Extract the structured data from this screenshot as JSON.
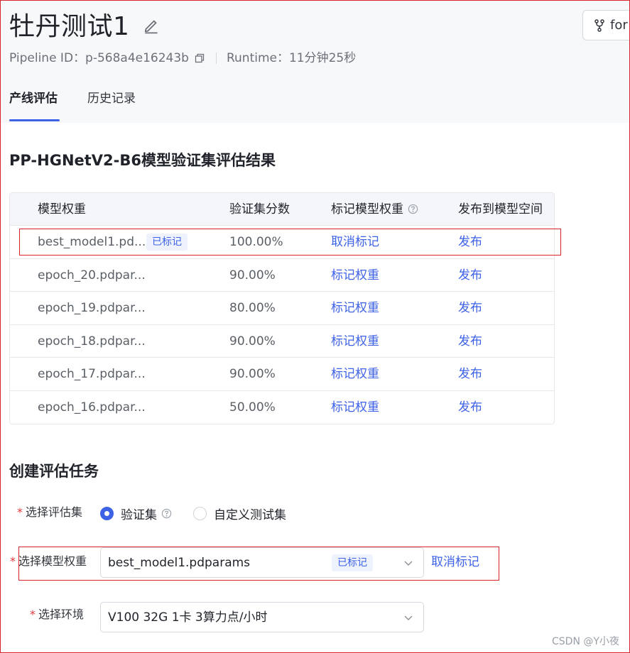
{
  "header": {
    "title": "牡丹测试1",
    "fork_label": "for",
    "pipeline_id": "Pipeline ID：p-568a4e16243b",
    "runtime": "Runtime：11分钟25秒"
  },
  "tabs": [
    {
      "label": "产线评估",
      "active": true
    },
    {
      "label": "历史记录",
      "active": false
    }
  ],
  "results": {
    "title": "PP-HGNetV2-B6模型验证集评估结果",
    "columns": [
      "模型权重",
      "验证集分数",
      "标记模型权重",
      "发布到模型空间"
    ],
    "rows": [
      {
        "weight": "best_model1.pd...",
        "badge": "已标记",
        "score": "100.00%",
        "mark": "取消标记",
        "publish": "发布"
      },
      {
        "weight": "epoch_20.pdpar...",
        "badge": "",
        "score": "90.00%",
        "mark": "标记权重",
        "publish": "发布"
      },
      {
        "weight": "epoch_19.pdpar...",
        "badge": "",
        "score": "80.00%",
        "mark": "标记权重",
        "publish": "发布"
      },
      {
        "weight": "epoch_18.pdpar...",
        "badge": "",
        "score": "90.00%",
        "mark": "标记权重",
        "publish": "发布"
      },
      {
        "weight": "epoch_17.pdpar...",
        "badge": "",
        "score": "90.00%",
        "mark": "标记权重",
        "publish": "发布"
      },
      {
        "weight": "epoch_16.pdpar...",
        "badge": "",
        "score": "50.00%",
        "mark": "标记权重",
        "publish": "发布"
      }
    ]
  },
  "create_task": {
    "title": "创建评估任务",
    "eval_set_label": "选择评估集",
    "eval_options": [
      {
        "label": "验证集",
        "checked": true
      },
      {
        "label": "自定义测试集",
        "checked": false
      }
    ],
    "weight_label": "选择模型权重",
    "weight_value": "best_model1.pdparams",
    "weight_badge": "已标记",
    "weight_action": "取消标记",
    "env_label": "选择环境",
    "env_value": "V100 32G 1卡 3算力点/小时"
  },
  "watermark": "CSDN @Y小夜",
  "colors": {
    "accent": "#3d62e6",
    "annotation": "#d9242c"
  }
}
